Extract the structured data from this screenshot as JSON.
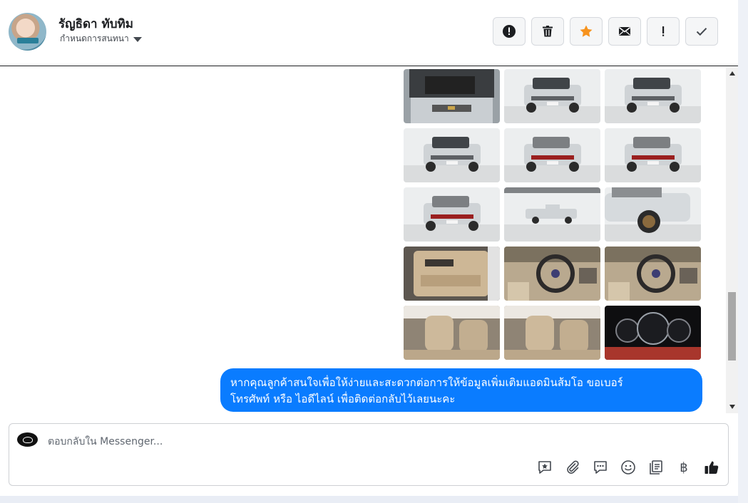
{
  "header": {
    "contact_name": "รัญธิดา ทับทิม",
    "assign_label": "กำหนดการสนทนา",
    "actions": [
      {
        "icon": "alert-circle-icon",
        "label": "report"
      },
      {
        "icon": "trash-icon",
        "label": "delete"
      },
      {
        "icon": "star-icon",
        "label": "star"
      },
      {
        "icon": "mail-icon",
        "label": "mark unread"
      },
      {
        "icon": "exclamation-icon",
        "label": "spam"
      },
      {
        "icon": "check-icon",
        "label": "done"
      }
    ]
  },
  "conversation": {
    "photos": [
      {
        "subject": "engine bay"
      },
      {
        "subject": "truck front three-quarter"
      },
      {
        "subject": "truck front"
      },
      {
        "subject": "truck front side"
      },
      {
        "subject": "truck rear three-quarter"
      },
      {
        "subject": "truck rear"
      },
      {
        "subject": "truck rear side"
      },
      {
        "subject": "truck side in showroom"
      },
      {
        "subject": "truck front closeup"
      },
      {
        "subject": "door panel interior"
      },
      {
        "subject": "steering wheel"
      },
      {
        "subject": "steering wheel closeup"
      },
      {
        "subject": "front seats"
      },
      {
        "subject": "rear seat"
      },
      {
        "subject": "gauge cluster"
      }
    ],
    "message_line_1": "หากคุณลูกค้าสนใจเพื่อให้ง่ายและสะดวกต่อการให้ข้อมูลเพิ่มเติมแอดมินส้มโอ ขอเบอร์",
    "message_line_2": "โทรศัพท์ หรือ ไอดีไลน์ เพื่อติดต่อกลับไว้เลยนะคะ"
  },
  "composer": {
    "placeholder": "ตอบกลับใน Messenger...",
    "baht_symbol": "฿",
    "tools": [
      "star-comment-icon",
      "paperclip-icon",
      "saved-reply-icon",
      "emoji-icon",
      "catalog-icon",
      "payment-icon",
      "thumbs-up-icon"
    ]
  },
  "colors": {
    "bubble": "#0a7cff",
    "star": "#f7931e",
    "text": "#1c1e21"
  }
}
